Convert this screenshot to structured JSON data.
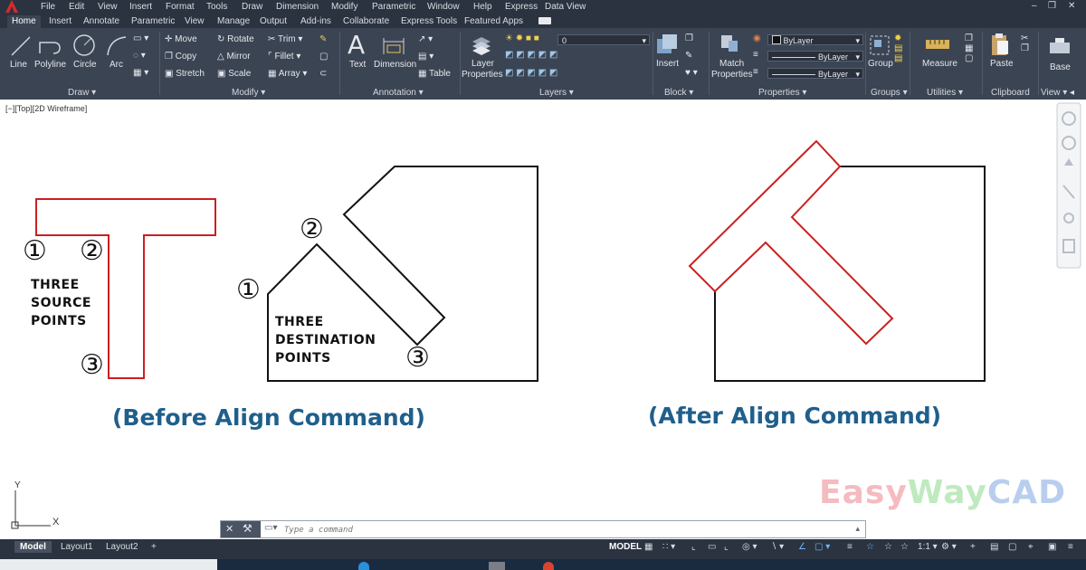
{
  "menu": [
    "File",
    "Edit",
    "View",
    "Insert",
    "Format",
    "Tools",
    "Draw",
    "Dimension",
    "Modify",
    "Parametric",
    "Window",
    "Help",
    "Express",
    "Data View"
  ],
  "tabs": [
    "Home",
    "Insert",
    "Annotate",
    "Parametric",
    "View",
    "Manage",
    "Output",
    "Add-ins",
    "Collaborate",
    "Express Tools",
    "Featured Apps"
  ],
  "ribbon": {
    "draw": {
      "title": "Draw",
      "line": "Line",
      "polyline": "Polyline",
      "circle": "Circle",
      "arc": "Arc"
    },
    "modify": {
      "title": "Modify",
      "move": "Move",
      "rotate": "Rotate",
      "trim": "Trim",
      "copy": "Copy",
      "mirror": "Mirror",
      "fillet": "Fillet",
      "stretch": "Stretch",
      "scale": "Scale",
      "array": "Array"
    },
    "annotation": {
      "title": "Annotation",
      "text": "Text",
      "dimension": "Dimension",
      "table": "Table"
    },
    "layers": {
      "title": "Layers",
      "layer_properties_1": "Layer",
      "layer_properties_2": "Properties",
      "current_layer": "0"
    },
    "block": {
      "title": "Block",
      "insert": "Insert"
    },
    "properties": {
      "title": "Properties",
      "match_1": "Match",
      "match_2": "Properties",
      "color": "ByLayer",
      "linetype": "ByLayer",
      "lineweight": "ByLayer"
    },
    "groups": {
      "title": "Groups",
      "group": "Group"
    },
    "utilities": {
      "title": "Utilities",
      "measure": "Measure"
    },
    "clipboard": {
      "title": "Clipboard",
      "paste": "Paste"
    },
    "view": {
      "title": "View",
      "base": "Base"
    }
  },
  "viewport_label": "[−][Top][2D Wireframe]",
  "drawing": {
    "source_marks": [
      "①",
      "②",
      "③"
    ],
    "dest_marks": [
      "①",
      "②",
      "③"
    ],
    "source_text": [
      "THREE",
      "SOURCE",
      "POINTS"
    ],
    "dest_text": [
      "THREE",
      "DESTINATION",
      "POINTS"
    ],
    "before_caption": "(Before Align Command)",
    "after_caption": "(After Align Command)",
    "brand": {
      "part1": "Easy",
      "part2": "Way",
      "part3": "CAD"
    },
    "ucs_y": "Y",
    "ucs_x": "X"
  },
  "colors": {
    "shape_red": "#cc1f1f",
    "caption_blue": "#1f5f8b",
    "brand_pink": "#e0303f",
    "brand_green": "#3cbf3c",
    "brand_blue": "#2a6ad0"
  },
  "command": {
    "placeholder": "Type a command"
  },
  "status": {
    "layouts": [
      "Model",
      "Layout1",
      "Layout2"
    ],
    "model": "MODEL",
    "scale": "1:1"
  }
}
